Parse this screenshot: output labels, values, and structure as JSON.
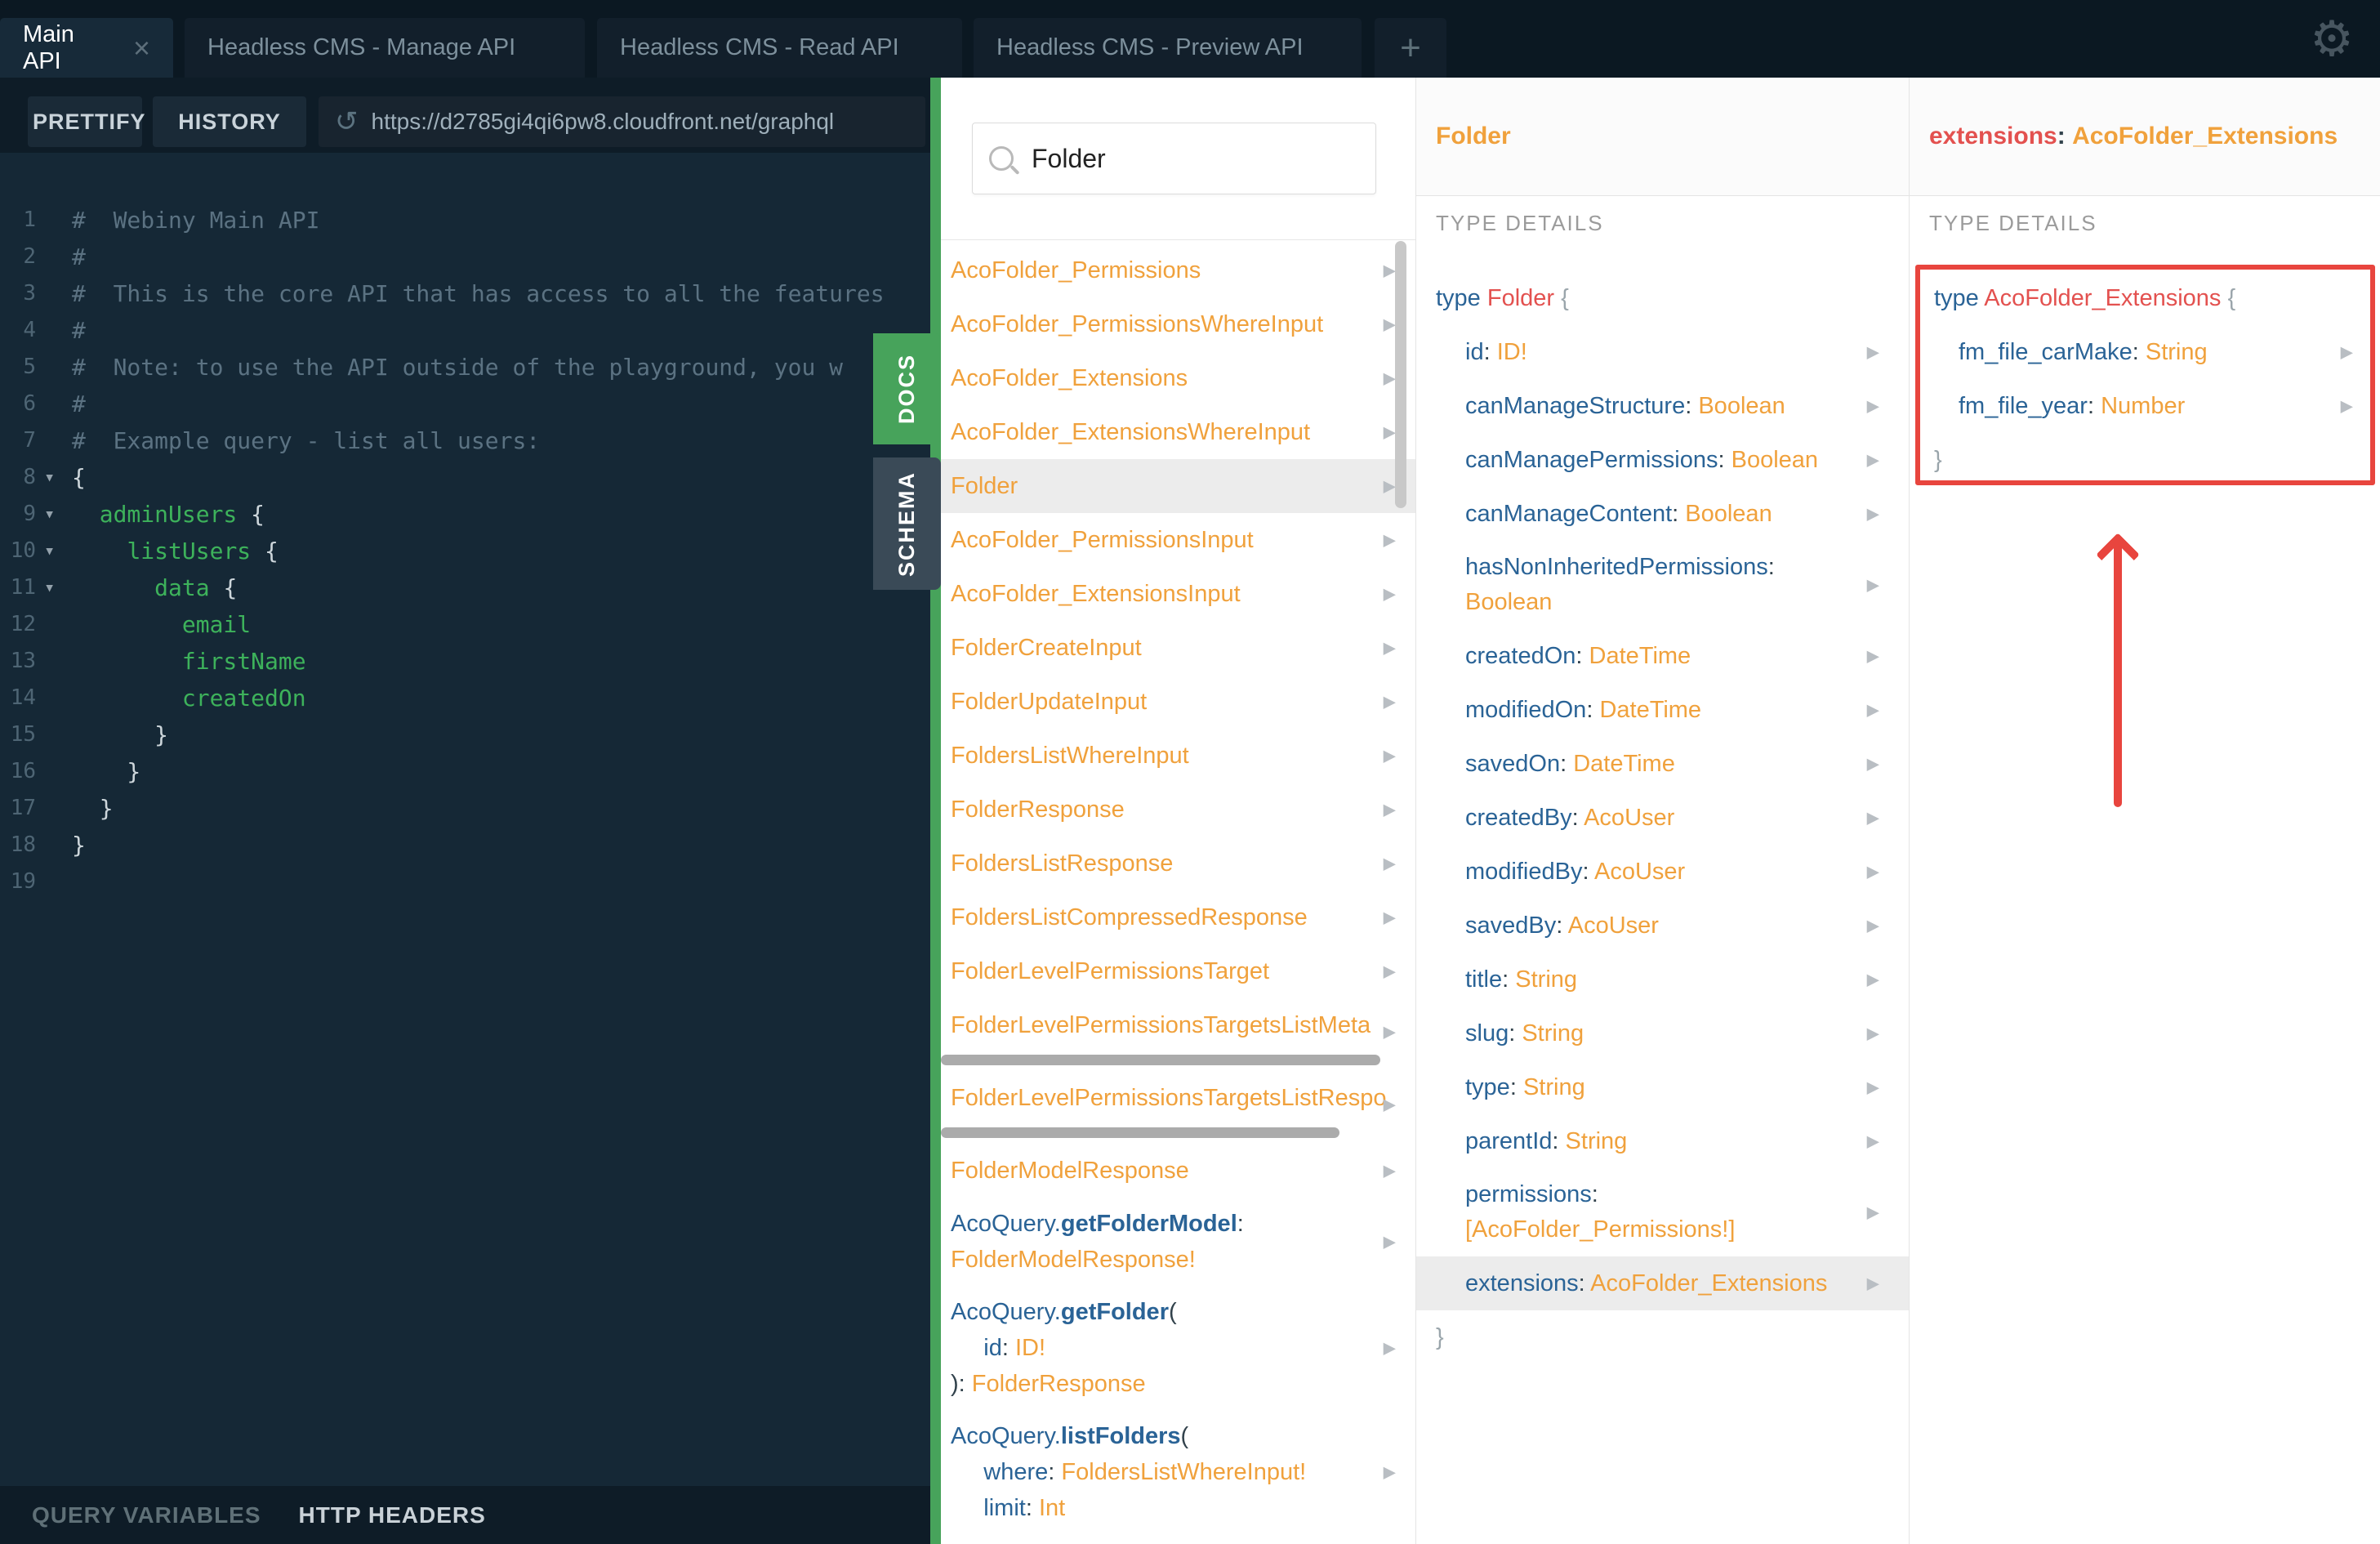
{
  "colors": {
    "accent_green": "#47a35b",
    "annotation_red": "#e8453e",
    "type_orange": "#f0a13c",
    "field_blue": "#2a6396",
    "type_red": "#e3514f",
    "editor_green": "#3db25b",
    "highlight_gray": "#ececec",
    "editor_bg": "#152836",
    "topbar_bg": "#0b1822"
  },
  "icons": {
    "close": "×",
    "plus": "+",
    "gear": "⚙",
    "refresh": "↺",
    "caret": "▾",
    "arrow_right": "▶"
  },
  "tabs": {
    "items": [
      {
        "label": "Main API",
        "active": true
      },
      {
        "label": "Headless CMS - Manage API",
        "active": false
      },
      {
        "label": "Headless CMS - Read API",
        "active": false
      },
      {
        "label": "Headless CMS - Preview API",
        "active": false
      }
    ]
  },
  "toolbar": {
    "prettify": "PRETTIFY",
    "history": "HISTORY",
    "url": "https://d2785gi4qi6pw8.cloudfront.net/graphql"
  },
  "bottombar": {
    "query_variables": "QUERY VARIABLES",
    "http_headers": "HTTP HEADERS"
  },
  "side_tabs": {
    "docs": "DOCS",
    "schema": "SCHEMA"
  },
  "editor": {
    "lines": [
      {
        "n": 1,
        "lines": [
          [
            {
              "t": "#  Webiny Main API",
              "c": "cm"
            }
          ]
        ]
      },
      {
        "n": 2,
        "lines": [
          [
            {
              "t": "#",
              "c": "cm"
            }
          ]
        ]
      },
      {
        "n": 3,
        "lines": [
          [
            {
              "t": "#  This is the core API that has access to all the features",
              "c": "cm"
            }
          ]
        ]
      },
      {
        "n": 4,
        "lines": [
          [
            {
              "t": "#",
              "c": "cm"
            }
          ]
        ]
      },
      {
        "n": 5,
        "lines": [
          [
            {
              "t": "#  Note: to use the API outside of the playground, you w",
              "c": "cm"
            }
          ]
        ]
      },
      {
        "n": 6,
        "lines": [
          [
            {
              "t": "#",
              "c": "cm"
            }
          ]
        ]
      },
      {
        "n": 7,
        "lines": [
          [
            {
              "t": "#  Example query - list all users:",
              "c": "cm"
            }
          ]
        ]
      },
      {
        "n": 8,
        "fold": true,
        "lines": [
          [
            {
              "t": "{",
              "c": "p"
            }
          ]
        ]
      },
      {
        "n": 9,
        "fold": true,
        "lines": [
          [
            {
              "t": "  ",
              "c": "p"
            },
            {
              "t": "adminUsers ",
              "c": "g"
            },
            {
              "t": "{",
              "c": "p"
            }
          ]
        ]
      },
      {
        "n": 10,
        "fold": true,
        "lines": [
          [
            {
              "t": "    ",
              "c": "p"
            },
            {
              "t": "listUsers ",
              "c": "g"
            },
            {
              "t": "{",
              "c": "p"
            }
          ]
        ]
      },
      {
        "n": 11,
        "fold": true,
        "lines": [
          [
            {
              "t": "      ",
              "c": "p"
            },
            {
              "t": "data ",
              "c": "g"
            },
            {
              "t": "{",
              "c": "p"
            }
          ]
        ]
      },
      {
        "n": 12,
        "lines": [
          [
            {
              "t": "        ",
              "c": "p"
            },
            {
              "t": "email",
              "c": "g"
            }
          ]
        ]
      },
      {
        "n": 13,
        "lines": [
          [
            {
              "t": "        ",
              "c": "p"
            },
            {
              "t": "firstName",
              "c": "g"
            }
          ]
        ]
      },
      {
        "n": 14,
        "lines": [
          [
            {
              "t": "        ",
              "c": "p"
            },
            {
              "t": "createdOn",
              "c": "g"
            }
          ]
        ]
      },
      {
        "n": 15,
        "lines": [
          [
            {
              "t": "      }",
              "c": "p"
            }
          ]
        ]
      },
      {
        "n": 16,
        "lines": [
          [
            {
              "t": "    }",
              "c": "p"
            }
          ]
        ]
      },
      {
        "n": 17,
        "lines": [
          [
            {
              "t": "  }",
              "c": "p"
            }
          ]
        ]
      },
      {
        "n": 18,
        "lines": [
          [
            {
              "t": "}",
              "c": "p"
            }
          ]
        ]
      },
      {
        "n": 19,
        "lines": [
          []
        ]
      }
    ]
  },
  "docs": {
    "search_value": "Folder",
    "items": [
      {
        "arrow": true,
        "lines": [
          [
            {
              "t": "AcoFolder_Permissions",
              "c": "o"
            }
          ]
        ]
      },
      {
        "arrow": true,
        "lines": [
          [
            {
              "t": "AcoFolder_PermissionsWhereInput",
              "c": "o"
            }
          ]
        ]
      },
      {
        "arrow": true,
        "lines": [
          [
            {
              "t": "AcoFolder_Extensions",
              "c": "o"
            }
          ]
        ]
      },
      {
        "arrow": true,
        "lines": [
          [
            {
              "t": "AcoFolder_ExtensionsWhereInput",
              "c": "o"
            }
          ]
        ]
      },
      {
        "arrow": true,
        "hl": true,
        "lines": [
          [
            {
              "t": "Folder",
              "c": "o"
            }
          ]
        ]
      },
      {
        "arrow": true,
        "lines": [
          [
            {
              "t": "AcoFolder_PermissionsInput",
              "c": "o"
            }
          ]
        ]
      },
      {
        "arrow": true,
        "lines": [
          [
            {
              "t": "AcoFolder_ExtensionsInput",
              "c": "o"
            }
          ]
        ]
      },
      {
        "arrow": true,
        "lines": [
          [
            {
              "t": "FolderCreateInput",
              "c": "o"
            }
          ]
        ]
      },
      {
        "arrow": true,
        "lines": [
          [
            {
              "t": "FolderUpdateInput",
              "c": "o"
            }
          ]
        ]
      },
      {
        "arrow": true,
        "lines": [
          [
            {
              "t": "FoldersListWhereInput",
              "c": "o"
            }
          ]
        ]
      },
      {
        "arrow": true,
        "lines": [
          [
            {
              "t": "FolderResponse",
              "c": "o"
            }
          ]
        ]
      },
      {
        "arrow": true,
        "lines": [
          [
            {
              "t": "FoldersListResponse",
              "c": "o"
            }
          ]
        ]
      },
      {
        "arrow": true,
        "lines": [
          [
            {
              "t": "FoldersListCompressedResponse",
              "c": "o"
            }
          ]
        ]
      },
      {
        "arrow": true,
        "lines": [
          [
            {
              "t": "FolderLevelPermissionsTarget",
              "c": "o"
            }
          ]
        ]
      },
      {
        "arrow": true,
        "hbar": true,
        "hbar_w": 538,
        "lines": [
          [
            {
              "t": "FolderLevelPermissionsTargetsListMeta",
              "c": "o"
            }
          ]
        ]
      },
      {
        "arrow": true,
        "hbar": true,
        "hbar_w": 488,
        "lines": [
          [
            {
              "t": "FolderLevelPermissionsTargetsListRespo",
              "c": "o"
            }
          ]
        ]
      },
      {
        "arrow": true,
        "lines": [
          [
            {
              "t": "FolderModelResponse",
              "c": "o"
            }
          ]
        ]
      },
      {
        "arrow": true,
        "lines": [
          [
            {
              "t": "AcoQuery.",
              "c": "b"
            },
            {
              "t": "getFolderModel",
              "c": "bb"
            },
            {
              "t": ":",
              "c": "d"
            }
          ],
          [
            {
              "t": "FolderModelResponse!",
              "c": "o"
            }
          ]
        ]
      },
      {
        "arrow": true,
        "lines": [
          [
            {
              "t": "AcoQuery.",
              "c": "b"
            },
            {
              "t": "getFolder",
              "c": "bb"
            },
            {
              "t": "(",
              "c": "d"
            }
          ],
          [
            {
              "t": "     id",
              "c": "b"
            },
            {
              "t": ": ",
              "c": "d"
            },
            {
              "t": "ID!",
              "c": "o"
            }
          ],
          [
            {
              "t": ")",
              "c": "d"
            },
            {
              "t": ": ",
              "c": "d"
            },
            {
              "t": "FolderResponse",
              "c": "o"
            }
          ]
        ]
      },
      {
        "arrow": true,
        "lines": [
          [
            {
              "t": "AcoQuery.",
              "c": "b"
            },
            {
              "t": "listFolders",
              "c": "bb"
            },
            {
              "t": "(",
              "c": "d"
            }
          ],
          [
            {
              "t": "     where",
              "c": "b"
            },
            {
              "t": ": ",
              "c": "d"
            },
            {
              "t": "FoldersListWhereInput!",
              "c": "o"
            }
          ],
          [
            {
              "t": "     limit",
              "c": "b"
            },
            {
              "t": ": ",
              "c": "d"
            },
            {
              "t": "Int",
              "c": "o"
            }
          ]
        ]
      }
    ]
  },
  "type_panel": {
    "title": "Folder",
    "section": "TYPE DETAILS",
    "rows": [
      {
        "lines": [
          [
            {
              "t": "type ",
              "c": "b"
            },
            {
              "t": "Folder ",
              "c": "r"
            },
            {
              "t": "{",
              "c": "gy"
            }
          ]
        ]
      },
      {
        "ind": true,
        "arrow": true,
        "lines": [
          [
            {
              "t": "id",
              "c": "b"
            },
            {
              "t": ": ",
              "c": "d"
            },
            {
              "t": "ID!",
              "c": "o"
            }
          ]
        ]
      },
      {
        "ind": true,
        "arrow": true,
        "lines": [
          [
            {
              "t": "canManageStructure",
              "c": "b"
            },
            {
              "t": ": ",
              "c": "d"
            },
            {
              "t": "Boolean",
              "c": "o"
            }
          ]
        ]
      },
      {
        "ind": true,
        "arrow": true,
        "lines": [
          [
            {
              "t": "canManagePermissions",
              "c": "b"
            },
            {
              "t": ": ",
              "c": "d"
            },
            {
              "t": "Boolean",
              "c": "o"
            }
          ]
        ]
      },
      {
        "ind": true,
        "arrow": true,
        "lines": [
          [
            {
              "t": "canManageContent",
              "c": "b"
            },
            {
              "t": ": ",
              "c": "d"
            },
            {
              "t": "Boolean",
              "c": "o"
            }
          ]
        ]
      },
      {
        "ind": true,
        "arrow": true,
        "lines": [
          [
            {
              "t": "hasNonInheritedPermissions",
              "c": "b"
            },
            {
              "t": ":",
              "c": "d"
            }
          ],
          [
            {
              "t": "Boolean",
              "c": "o"
            }
          ]
        ]
      },
      {
        "ind": true,
        "arrow": true,
        "lines": [
          [
            {
              "t": "createdOn",
              "c": "b"
            },
            {
              "t": ": ",
              "c": "d"
            },
            {
              "t": "DateTime",
              "c": "o"
            }
          ]
        ]
      },
      {
        "ind": true,
        "arrow": true,
        "lines": [
          [
            {
              "t": "modifiedOn",
              "c": "b"
            },
            {
              "t": ": ",
              "c": "d"
            },
            {
              "t": "DateTime",
              "c": "o"
            }
          ]
        ]
      },
      {
        "ind": true,
        "arrow": true,
        "lines": [
          [
            {
              "t": "savedOn",
              "c": "b"
            },
            {
              "t": ": ",
              "c": "d"
            },
            {
              "t": "DateTime",
              "c": "o"
            }
          ]
        ]
      },
      {
        "ind": true,
        "arrow": true,
        "lines": [
          [
            {
              "t": "createdBy",
              "c": "b"
            },
            {
              "t": ": ",
              "c": "d"
            },
            {
              "t": "AcoUser",
              "c": "o"
            }
          ]
        ]
      },
      {
        "ind": true,
        "arrow": true,
        "lines": [
          [
            {
              "t": "modifiedBy",
              "c": "b"
            },
            {
              "t": ": ",
              "c": "d"
            },
            {
              "t": "AcoUser",
              "c": "o"
            }
          ]
        ]
      },
      {
        "ind": true,
        "arrow": true,
        "lines": [
          [
            {
              "t": "savedBy",
              "c": "b"
            },
            {
              "t": ": ",
              "c": "d"
            },
            {
              "t": "AcoUser",
              "c": "o"
            }
          ]
        ]
      },
      {
        "ind": true,
        "arrow": true,
        "lines": [
          [
            {
              "t": "title",
              "c": "b"
            },
            {
              "t": ": ",
              "c": "d"
            },
            {
              "t": "String",
              "c": "o"
            }
          ]
        ]
      },
      {
        "ind": true,
        "arrow": true,
        "lines": [
          [
            {
              "t": "slug",
              "c": "b"
            },
            {
              "t": ": ",
              "c": "d"
            },
            {
              "t": "String",
              "c": "o"
            }
          ]
        ]
      },
      {
        "ind": true,
        "arrow": true,
        "lines": [
          [
            {
              "t": "type",
              "c": "b"
            },
            {
              "t": ": ",
              "c": "d"
            },
            {
              "t": "String",
              "c": "o"
            }
          ]
        ]
      },
      {
        "ind": true,
        "arrow": true,
        "lines": [
          [
            {
              "t": "parentId",
              "c": "b"
            },
            {
              "t": ": ",
              "c": "d"
            },
            {
              "t": "String",
              "c": "o"
            }
          ]
        ]
      },
      {
        "ind": true,
        "arrow": true,
        "lines": [
          [
            {
              "t": "permissions",
              "c": "b"
            },
            {
              "t": ":",
              "c": "d"
            }
          ],
          [
            {
              "t": "[AcoFolder_Permissions!]",
              "c": "o"
            }
          ]
        ]
      },
      {
        "ind": true,
        "arrow": true,
        "hl": true,
        "lines": [
          [
            {
              "t": "extensions",
              "c": "b"
            },
            {
              "t": ": ",
              "c": "d"
            },
            {
              "t": "AcoFolder_Extensions",
              "c": "o"
            }
          ]
        ]
      },
      {
        "lines": [
          [
            {
              "t": "}",
              "c": "gy"
            }
          ]
        ]
      }
    ]
  },
  "ext_panel": {
    "title_field": "extensions",
    "title_colon": ": ",
    "title_type": "AcoFolder_Extensions",
    "section": "TYPE DETAILS",
    "rows": [
      {
        "lines": [
          [
            {
              "t": "type ",
              "c": "b"
            },
            {
              "t": "AcoFolder_Extensions ",
              "c": "r"
            },
            {
              "t": "{",
              "c": "gy"
            }
          ]
        ]
      },
      {
        "ind": true,
        "arrow": true,
        "lines": [
          [
            {
              "t": "fm_file_carMake",
              "c": "b"
            },
            {
              "t": ": ",
              "c": "d"
            },
            {
              "t": "String",
              "c": "o"
            }
          ]
        ]
      },
      {
        "ind": true,
        "arrow": true,
        "lines": [
          [
            {
              "t": "fm_file_year",
              "c": "b"
            },
            {
              "t": ": ",
              "c": "d"
            },
            {
              "t": "Number",
              "c": "o"
            }
          ]
        ]
      },
      {
        "lines": [
          [
            {
              "t": "}",
              "c": "gy"
            }
          ]
        ]
      }
    ]
  }
}
